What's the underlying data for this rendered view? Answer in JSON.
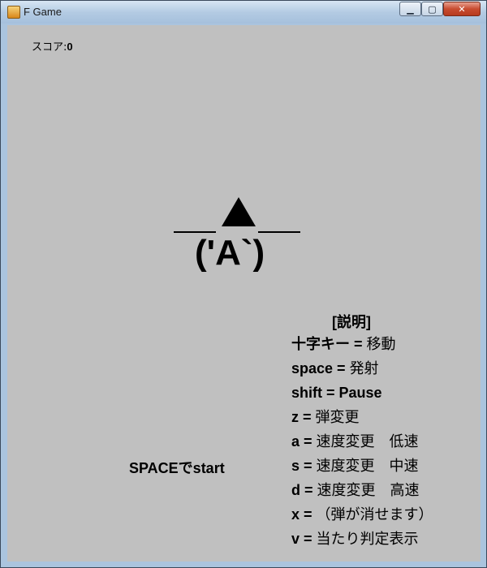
{
  "window": {
    "title": "F Game",
    "buttons": {
      "minimize": "▁",
      "maximize": "▢",
      "close": "✕"
    }
  },
  "hud": {
    "score_label": "スコア:",
    "score_value": "0"
  },
  "player": {
    "face": "('A`)",
    "icon": "player-ship-icon"
  },
  "start_prompt": "SPACEでstart",
  "help": {
    "title": "[説明]",
    "items": [
      {
        "key": "十字キー",
        "sep": " = ",
        "desc": "移動"
      },
      {
        "key": "space",
        "sep": " = ",
        "desc": "発射"
      },
      {
        "key": "shift",
        "sep": " = ",
        "desc": "Pause"
      },
      {
        "key": "z",
        "sep": " = ",
        "desc": "弾変更"
      },
      {
        "key": "a",
        "sep": " = ",
        "desc": "速度変更　低速"
      },
      {
        "key": "s",
        "sep": " = ",
        "desc": "速度変更　中速"
      },
      {
        "key": "d",
        "sep": " = ",
        "desc": "速度変更　高速"
      },
      {
        "key": "x",
        "sep": " = ",
        "desc": "（弾が消せます）"
      },
      {
        "key": "v",
        "sep": " = ",
        "desc": "当たり判定表示"
      }
    ]
  },
  "colors": {
    "background": "#c0c0c0",
    "foreground": "#000000"
  }
}
